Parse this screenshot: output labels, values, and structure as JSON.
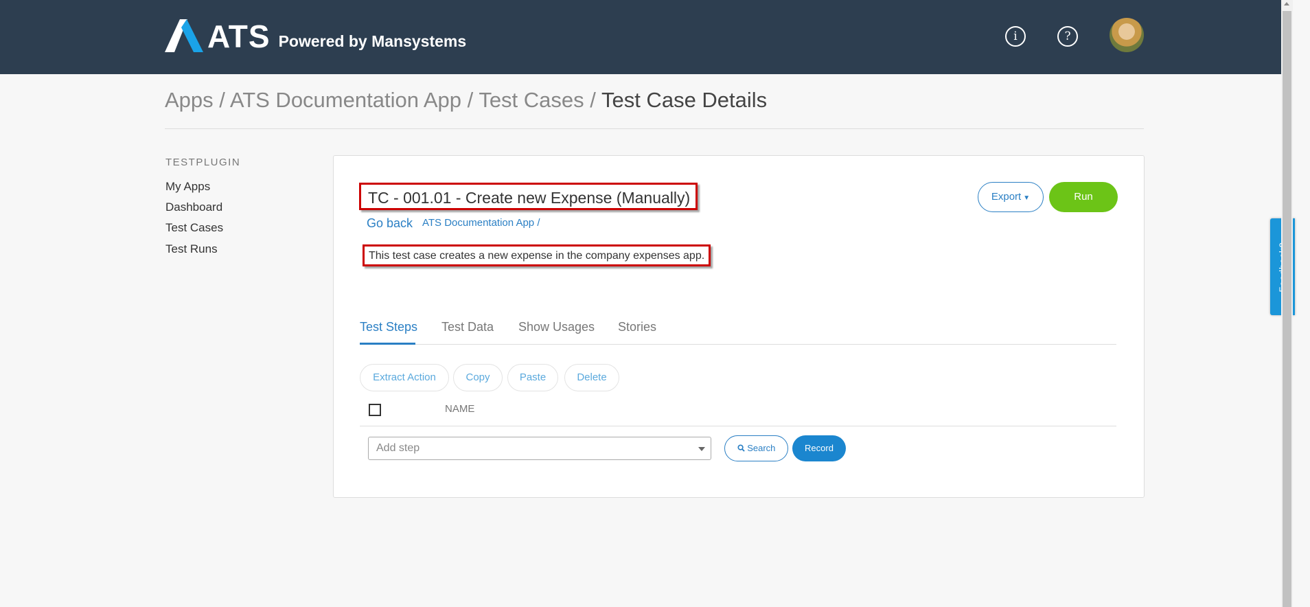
{
  "header": {
    "logo_text": "ATS",
    "powered_by": "Powered by Mansystems",
    "info_icon": "info-icon",
    "help_icon": "help-icon",
    "avatar": "user-avatar"
  },
  "breadcrumb": {
    "items": [
      "Apps",
      "ATS Documentation App",
      "Test Cases"
    ],
    "separator": "/",
    "current": "Test Case Details"
  },
  "sidebar": {
    "title": "TESTPLUGIN",
    "items": [
      "My Apps",
      "Dashboard",
      "Test Cases",
      "Test Runs"
    ]
  },
  "test_case": {
    "title": "TC - 001.01 - Create new Expense (Manually)",
    "go_back": "Go back",
    "app_link": "ATS Documentation App /",
    "description": "This test case creates a new expense in the company expenses app.",
    "export_label": "Export",
    "run_label": "Run"
  },
  "tabs": [
    "Test Steps",
    "Test Data",
    "Show Usages",
    "Stories"
  ],
  "active_tab": "Test Steps",
  "actions": [
    "Extract Action",
    "Copy",
    "Paste",
    "Delete"
  ],
  "table": {
    "column_name": "NAME"
  },
  "add_step": {
    "placeholder": "Add step"
  },
  "buttons": {
    "search": "Search",
    "record": "Record"
  },
  "feedback_label": "Feedback?",
  "colors": {
    "header_bg": "#2d3e50",
    "accent": "#2a7fc4",
    "run_green": "#6cc417",
    "highlight_red": "#cc0000",
    "feedback_blue": "#1b96d9"
  }
}
